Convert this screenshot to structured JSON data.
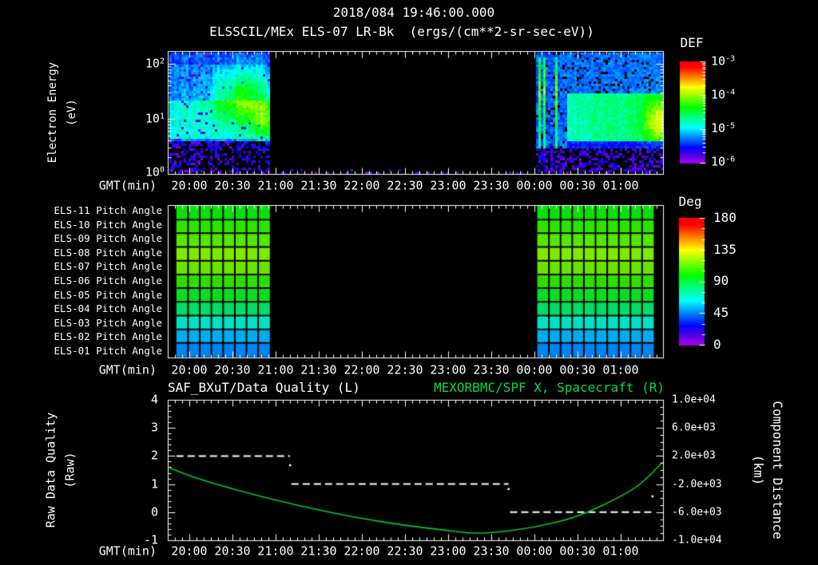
{
  "title": {
    "date_line": "2018/084 19:46:00.000",
    "instrument_line": "ELSSCIL/MEx ELS-07 LR-Bk  (ergs/(cm**2-sr-sec-eV))"
  },
  "time_axis": {
    "label": "GMT(min)",
    "ticks": [
      "20:00",
      "20:30",
      "21:00",
      "21:30",
      "22:00",
      "22:30",
      "23:00",
      "23:30",
      "00:00",
      "00:30",
      "01:00"
    ]
  },
  "energy_panel": {
    "ylabel": "Electron Energy",
    "ylabel_units": "(eV)",
    "yticks": [
      {
        "base": "10",
        "exp": "2"
      },
      {
        "base": "10",
        "exp": "1"
      },
      {
        "base": "10",
        "exp": "0"
      }
    ],
    "colorbar": {
      "title": "DEF",
      "ticks": [
        {
          "base": "10",
          "exp": "-3"
        },
        {
          "base": "10",
          "exp": "-4"
        },
        {
          "base": "10",
          "exp": "-5"
        },
        {
          "base": "10",
          "exp": "-6"
        }
      ]
    }
  },
  "pitch_panel": {
    "row_labels": [
      "ELS-11 Pitch Angle",
      "ELS-10 Pitch Angle",
      "ELS-09 Pitch Angle",
      "ELS-08 Pitch Angle",
      "ELS-07 Pitch Angle",
      "ELS-06 Pitch Angle",
      "ELS-05 Pitch Angle",
      "ELS-04 Pitch Angle",
      "ELS-03 Pitch Angle",
      "ELS-02 Pitch Angle",
      "ELS-01 Pitch Angle"
    ],
    "row_colors": [
      "#0ae00a",
      "#2ce400",
      "#55e600",
      "#7fe800",
      "#6ce200",
      "#30dc00",
      "#0cdc20",
      "#00dc66",
      "#00e2c4",
      "#00acee",
      "#0082f0"
    ],
    "colorbar": {
      "title": "Deg",
      "ticks": [
        "180",
        "135",
        "90",
        "45",
        "0"
      ]
    }
  },
  "quality_panel": {
    "title_left": "SAF_BXuT/Data Quality (L)",
    "title_right": "MEXORBMC/SPF X, Spacecraft (R)",
    "ylabel_left": "Raw Data Quality",
    "ylabel_left_units": "(Raw)",
    "ylabel_right": "Component Distance",
    "ylabel_right_units": "(km)",
    "yticks_left": [
      "4",
      "3",
      "2",
      "1",
      "0",
      "-1"
    ],
    "yticks_right": [
      "1.0e+04",
      "6.0e+03",
      "2.0e+03",
      "-2.0e+03",
      "-6.0e+03",
      "-1.0e+04"
    ]
  },
  "colors": {
    "background": "#000000",
    "text": "#ffffff",
    "title_right_green": "#00dc46",
    "curve_green": "#00c838",
    "quality_line": "#ffffff"
  },
  "chart_data": [
    {
      "type": "heatmap",
      "title": "ELSSCIL/MEx ELS-07 LR-Bk electron energy spectrogram",
      "xlabel": "GMT(min)",
      "ylabel": "Electron Energy (eV)",
      "y_scale": "log",
      "y_range_ev": [
        1,
        170
      ],
      "x_range": [
        "19:45",
        "01:30"
      ],
      "colorbar": {
        "label": "DEF",
        "units": "ergs/(cm**2-sr-sec-eV)",
        "scale": "log",
        "range": [
          1e-06,
          0.001
        ]
      },
      "data_segments": [
        {
          "start": "19:46",
          "end": "20:56",
          "description": "blue-purple noise, cyan band 3-20 eV, bright green enhancement 10-60 eV from about 20:20 to 20:55, sparse purple speckles below 2.5 eV"
        },
        {
          "start": "00:01",
          "end": "01:29",
          "description": "narrow vertical cyan-green bursts until about 00:12, then broad cyan band 3-30 eV strengthening toward 01:29 with a green patch 4-15 eV near 01:25, purple speckles below 2 eV"
        }
      ]
    },
    {
      "type": "heatmap",
      "title": "ELS pitch angles",
      "rows": [
        "ELS-11",
        "ELS-10",
        "ELS-09",
        "ELS-08",
        "ELS-07",
        "ELS-06",
        "ELS-05",
        "ELS-04",
        "ELS-03",
        "ELS-02",
        "ELS-01"
      ],
      "approx_values_deg": [
        99,
        105,
        111,
        117,
        115,
        105,
        94,
        84,
        69,
        53,
        47
      ],
      "colorbar": {
        "label": "Deg",
        "range": [
          0,
          180
        ]
      },
      "data_segments": [
        {
          "start": "19:51",
          "end": "20:56",
          "columns": 8
        },
        {
          "start": "00:02",
          "end": "01:23",
          "columns": 10
        }
      ]
    },
    {
      "type": "line",
      "xlabel": "GMT(min)",
      "ylim_left": [
        -1,
        4
      ],
      "ylim_right": [
        -10000,
        10000
      ],
      "series": [
        {
          "name": "SAF_BXuT/Data Quality (L)",
          "axis": "left",
          "style": "white dashed step line",
          "steps": [
            {
              "from": "19:51",
              "to": "21:10",
              "value": 2
            },
            {
              "from": "21:11",
              "to": "23:42",
              "value": 1
            },
            {
              "from": "23:43",
              "to": "01:22",
              "value": 0
            }
          ],
          "transition_points": [
            {
              "time": "21:10",
              "value": 1.68
            },
            {
              "time": "23:42",
              "value": 0.83
            },
            {
              "time": "01:22",
              "value": 0.57
            }
          ]
        },
        {
          "name": "MEXORBMC/SPF X, Spacecraft (R)",
          "axis": "right",
          "style": "green solid curve",
          "units": "km",
          "x_times": [
            "19:46",
            "20:00",
            "20:30",
            "21:00",
            "21:30",
            "22:00",
            "22:30",
            "23:00",
            "23:15",
            "23:30",
            "00:00",
            "00:30",
            "01:00",
            "01:15",
            "01:29"
          ],
          "values_km": [
            300,
            -900,
            -2700,
            -4300,
            -5700,
            -6900,
            -7900,
            -8600,
            -9000,
            -8950,
            -8200,
            -6700,
            -3800,
            -1900,
            1100
          ]
        }
      ]
    }
  ]
}
